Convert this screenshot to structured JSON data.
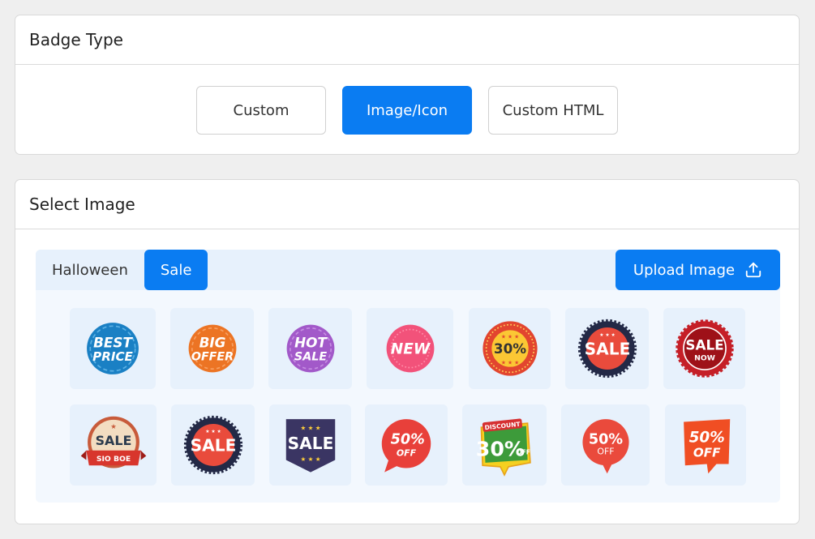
{
  "badge_type": {
    "title": "Badge Type",
    "options": [
      "Custom",
      "Image/Icon",
      "Custom HTML"
    ],
    "selected": "Image/Icon"
  },
  "select_image": {
    "title": "Select Image",
    "tabs": [
      "Halloween",
      "Sale"
    ],
    "active_tab": "Sale",
    "upload_label": "Upload Image",
    "upload_icon": "upload-icon",
    "badges": [
      {
        "line1": "BEST",
        "line2": "PRICE"
      },
      {
        "line1": "BIG",
        "line2": "OFFER"
      },
      {
        "line1": "HOT",
        "line2": "SALE"
      },
      {
        "line1": "NEW"
      },
      {
        "line1": "30%"
      },
      {
        "line1": "SALE"
      },
      {
        "line1": "SALE",
        "line2": "NOW"
      },
      {
        "line1": "SALE",
        "line2": "SIO BOE"
      },
      {
        "line1": "SALE"
      },
      {
        "line1": "SALE"
      },
      {
        "line1": "50%",
        "line2": "OFF"
      },
      {
        "line1": "DISCOUNT",
        "line2": "30%",
        "line3": "OFF"
      },
      {
        "line1": "50%",
        "line2": "OFF"
      },
      {
        "line1": "50%",
        "line2": "OFF"
      }
    ]
  },
  "colors": {
    "accent": "#0a7cf2",
    "tab_bar": "#e7f1fc",
    "panel": "#f3f8fe"
  }
}
